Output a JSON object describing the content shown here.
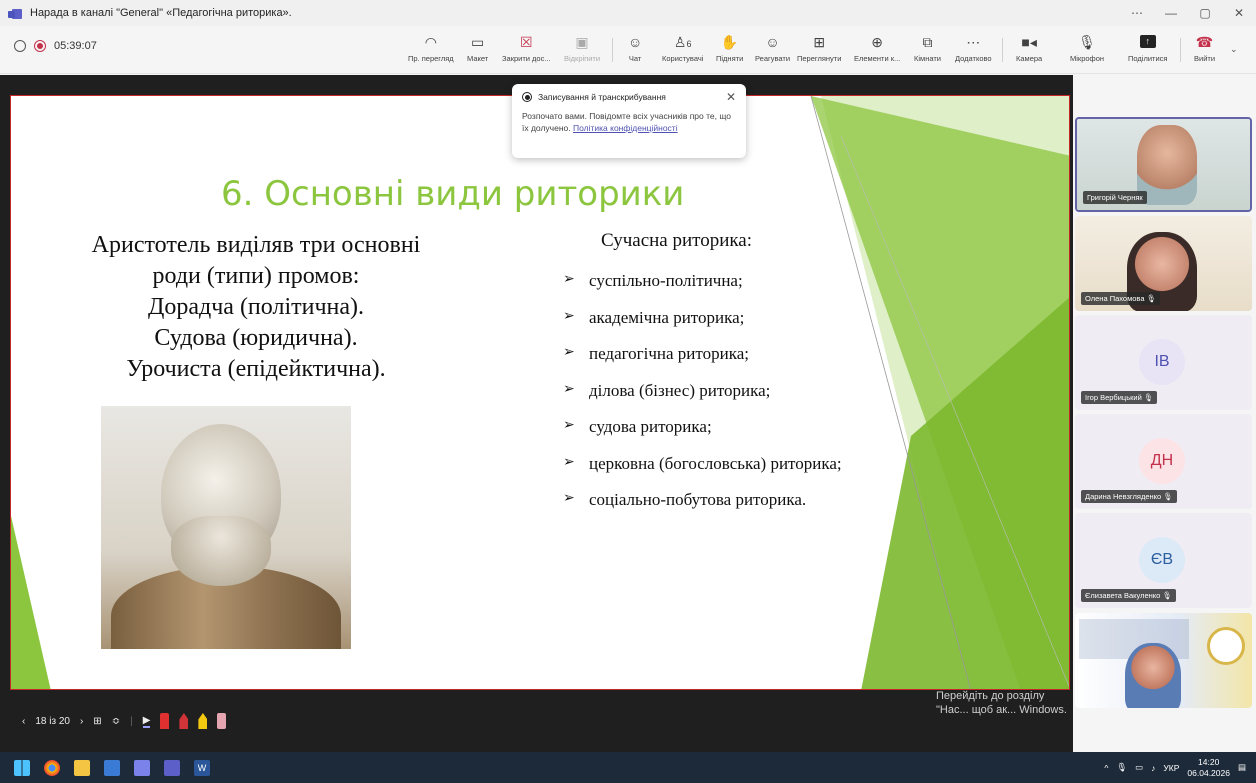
{
  "window": {
    "title": "Нарада в каналі \"General\" «Педагогічна риторика»."
  },
  "recording": {
    "timer": "05:39:07"
  },
  "toolbar": {
    "items": [
      {
        "label": "Пр. перегляд",
        "icon": "eye-icon"
      },
      {
        "label": "Макет",
        "icon": "layout-icon"
      },
      {
        "label": "Закрити дос...",
        "icon": "close-share-icon"
      },
      {
        "label": "Відкріпити",
        "icon": "unpin-icon"
      },
      {
        "label": "Чат",
        "icon": "chat-icon"
      },
      {
        "label": "Користувачі",
        "icon": "people-icon",
        "badge": "6"
      },
      {
        "label": "Підняти",
        "icon": "raise-hand-icon"
      },
      {
        "label": "Реагувати",
        "icon": "react-icon"
      },
      {
        "label": "Переглянути",
        "icon": "view-icon"
      },
      {
        "label": "Елементи к...",
        "icon": "apps-icon"
      },
      {
        "label": "Кімнати",
        "icon": "rooms-icon"
      },
      {
        "label": "Додатково",
        "icon": "more-icon"
      },
      {
        "label": "Камера",
        "icon": "camera-icon"
      },
      {
        "label": "Мікрофон",
        "icon": "mic-icon"
      },
      {
        "label": "Поділитися",
        "icon": "share-icon"
      },
      {
        "label": "Вийти",
        "icon": "leave-icon"
      }
    ]
  },
  "popup": {
    "title": "Записування й транскрибування",
    "body": "Розпочато вами. Повідомте всіх учасників про те, що їх долучено.",
    "link": "Політика конфіденційності"
  },
  "slide": {
    "title": "6. Основні види риторики",
    "left_lines": [
      "Аристотель виділяв три основні",
      "роди (типи) промов:",
      "Дорадча (політична).",
      "Судова (юридична).",
      "Урочиста (епідейктична)."
    ],
    "right_heading": "Сучасна риторика:",
    "bullets": [
      "суспільно-політична;",
      "академічна риторика;",
      "педагогічна риторика;",
      "ділова (бізнес) риторика;",
      "судова риторика;",
      "церковна (богословська) риторика;",
      "соціально-побутова риторика."
    ],
    "counter": "18 із 20"
  },
  "activate_notice": "Перейдіть до розділу \"Нас... щоб ак... Windows.",
  "participants": [
    {
      "name": "Григорій Черняк",
      "initials": "",
      "type": "video"
    },
    {
      "name": "Олена Пахомова",
      "initials": "",
      "type": "video"
    },
    {
      "name": "Ігор Вербицький",
      "initials": "ІВ",
      "type": "avatar",
      "color": "#e8e4f5",
      "text_color": "#4f52b2"
    },
    {
      "name": "Дарина Невзгляденко",
      "initials": "ДН",
      "type": "avatar",
      "color": "#fbe3e6",
      "text_color": "#c4314b"
    },
    {
      "name": "Єлизавета Вакуленко",
      "initials": "ЄВ",
      "type": "avatar",
      "color": "#dce9f7",
      "text_color": "#2b5f9e"
    }
  ],
  "taskbar": {
    "lang": "УКР",
    "time": "14:20",
    "date": "06.04.2026"
  }
}
